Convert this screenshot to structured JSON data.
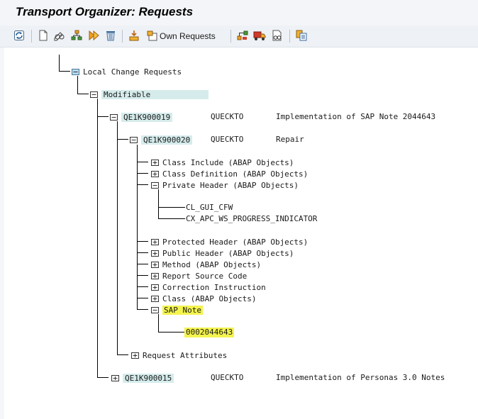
{
  "window": {
    "title": "Transport Organizer: Requests"
  },
  "toolbar": {
    "icons": [
      "refresh-icon",
      "new-document-icon",
      "display-change-icon",
      "structure-icon",
      "execute-icon",
      "delete-icon",
      "release-icon",
      "own-requests-icon",
      "object-list-icon",
      "truck-icon",
      "glasses-icon",
      "copy-icon"
    ],
    "own_requests_label": "Own Requests"
  },
  "tree": {
    "local_change_requests": "Local Change Requests",
    "modifiable": "Modifiable",
    "request_1": {
      "id": "QE1K900019",
      "owner": "QUECKTO",
      "description": "Implementation of SAP Note 2044643"
    },
    "task_1": {
      "id": "QE1K900020",
      "owner": "QUECKTO",
      "description": "Repair"
    },
    "objects": [
      "Class Include (ABAP Objects)",
      "Class Definition (ABAP Objects)",
      "Private Header (ABAP Objects)"
    ],
    "private_header_items": [
      "CL_GUI_CFW",
      "CX_APC_WS_PROGRESS_INDICATOR"
    ],
    "objects_2": [
      "Protected Header (ABAP Objects)",
      "Public Header (ABAP Objects)",
      "Method (ABAP Objects)",
      "Report Source Code",
      "Correction Instruction",
      "Class (ABAP Objects)",
      "SAP Note"
    ],
    "sap_note_number": "0002044643",
    "request_attributes": "Request Attributes",
    "request_2": {
      "id": "QE1K900015",
      "owner": "QUECKTO",
      "description": "Implementation of Personas 3.0 Notes"
    }
  }
}
